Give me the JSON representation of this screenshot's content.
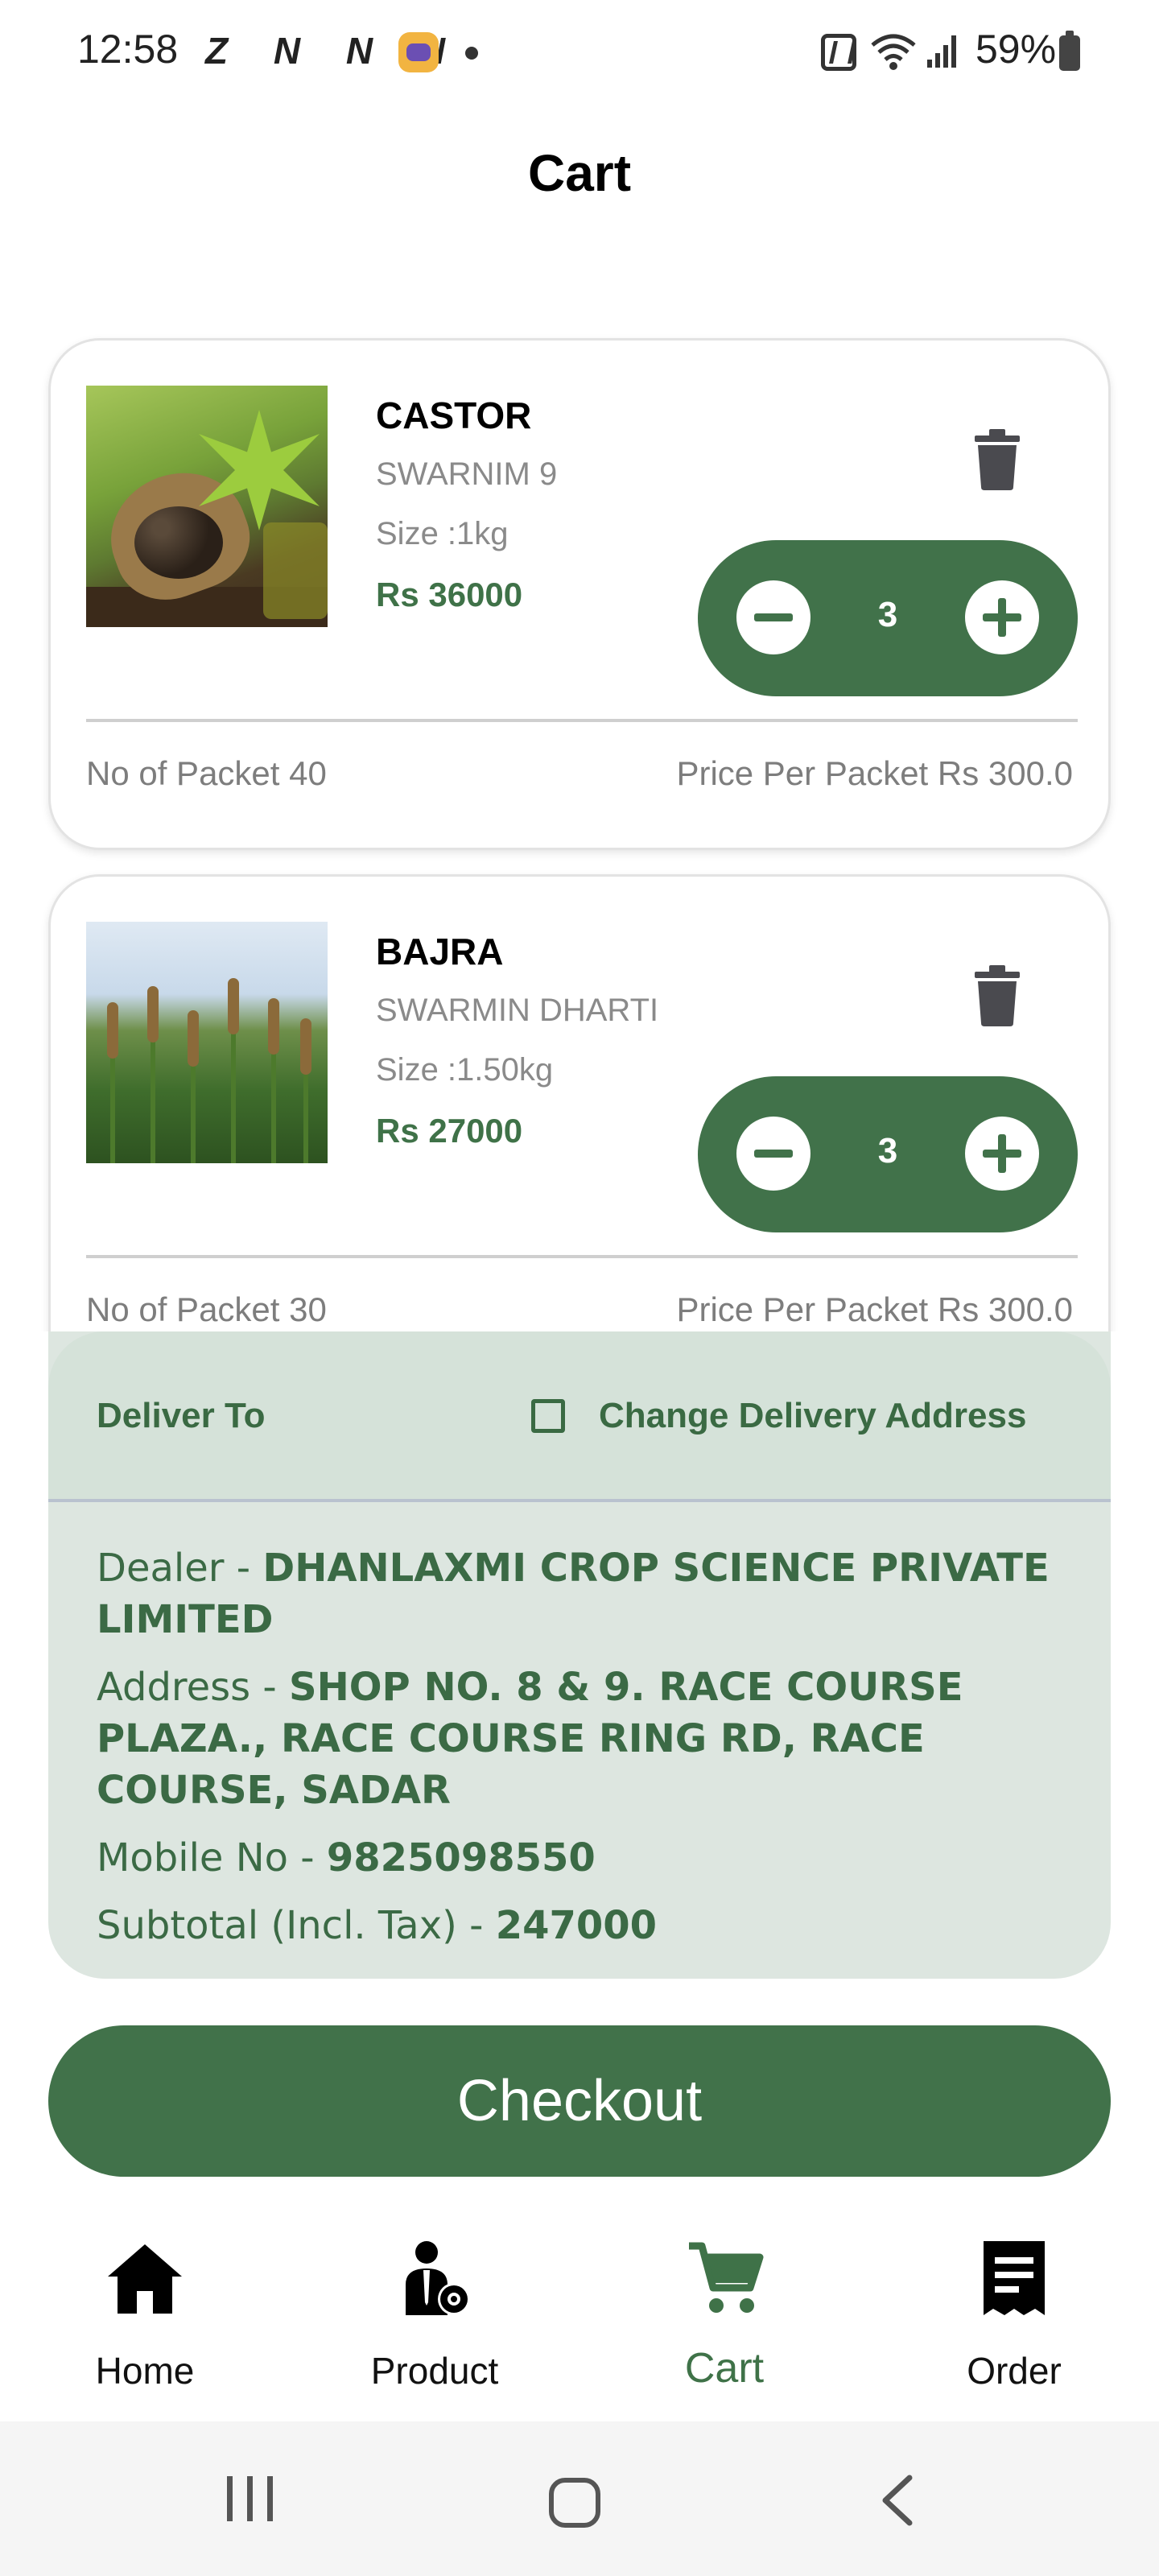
{
  "status_bar": {
    "time": "12:58",
    "notification_letters": "Z N N N",
    "battery": "59%"
  },
  "header": {
    "title": "Cart"
  },
  "cart": {
    "items": [
      {
        "name": "CASTOR",
        "variety": "SWARNIM 9",
        "size": "Size :1kg",
        "price": "Rs 36000",
        "quantity": "3",
        "packets": "No of Packet 40",
        "price_per_packet": "Price Per Packet Rs 300.0"
      },
      {
        "name": "BAJRA",
        "variety": "SWARMIN DHARTI",
        "size": "Size :1.50kg",
        "price": "Rs 27000",
        "quantity": "3",
        "packets": "No of Packet 30",
        "price_per_packet": "Price Per Packet Rs 300.0"
      }
    ]
  },
  "delivery": {
    "deliver_to_label": "Deliver To",
    "change_address_label": "Change Delivery Address",
    "change_address_checked": false,
    "dealer_label": "Dealer - ",
    "dealer_value": "DHANLAXMI CROP SCIENCE PRIVATE LIMITED",
    "address_label": "Address - ",
    "address_value": "SHOP NO. 8 & 9. RACE COURSE PLAZA., RACE COURSE RING RD, RACE COURSE, SADAR",
    "mobile_label": "Mobile No - ",
    "mobile_value": "9825098550",
    "subtotal_label": "Subtotal (Incl. Tax) - ",
    "subtotal_value": "247000"
  },
  "checkout": {
    "label": "Checkout"
  },
  "bottom_nav": {
    "items": [
      {
        "label": "Home",
        "icon": "home-icon"
      },
      {
        "label": "Product",
        "icon": "product-icon"
      },
      {
        "label": "Cart",
        "icon": "cart-icon",
        "active": true
      },
      {
        "label": "Order",
        "icon": "order-icon"
      }
    ]
  },
  "colors": {
    "primary_green": "#41724a",
    "panel_bg": "#dde6e0",
    "muted_text": "#8a8a8a"
  }
}
